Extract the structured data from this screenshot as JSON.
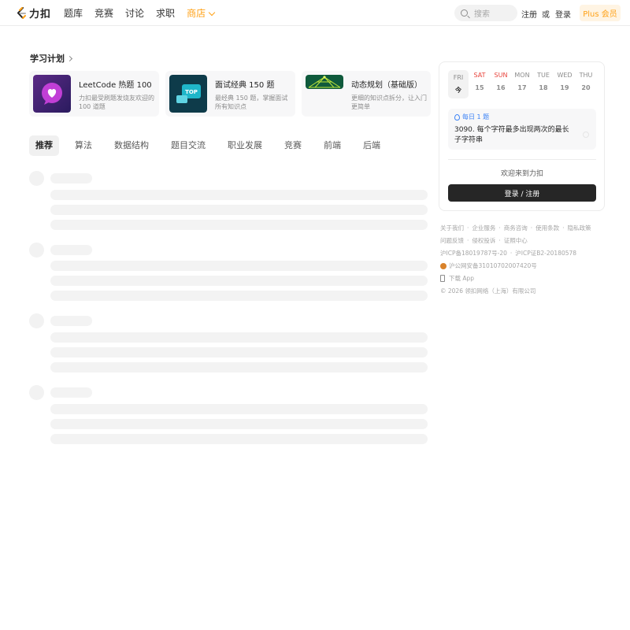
{
  "header": {
    "logo_text": "力扣",
    "nav": [
      "题库",
      "竞赛",
      "讨论",
      "求职"
    ],
    "shop_label": "商店",
    "search_placeholder": "搜索",
    "register": "注册",
    "or": "或",
    "login": "登录",
    "plus": "Plus 会员",
    "accent_color": "#ffa116"
  },
  "study_plan": {
    "title": "学习计划",
    "cards": [
      {
        "title": "LeetCode 热题 100",
        "desc": "力扣最受刷题发烧友欢迎的 100 道题",
        "icon": "chat-heart-icon"
      },
      {
        "title": "面试经典 150 题",
        "desc": "最经典 150 题，掌握面试所有知识点",
        "icon": "top-chat-icon"
      },
      {
        "title": "动态规划（基础版）",
        "desc": "更细的知识点拆分，让入门更简单",
        "icon": "network-graph-icon"
      }
    ]
  },
  "tabs": [
    "推荐",
    "算法",
    "数据结构",
    "题目交流",
    "职业发展",
    "竞赛",
    "前端",
    "后端"
  ],
  "calendar": {
    "days": [
      {
        "name": "FRI",
        "date": "今",
        "today": true
      },
      {
        "name": "SAT",
        "date": "15",
        "weekend": true
      },
      {
        "name": "SUN",
        "date": "16",
        "weekend": true
      },
      {
        "name": "MON",
        "date": "17"
      },
      {
        "name": "TUE",
        "date": "18"
      },
      {
        "name": "WED",
        "date": "19"
      },
      {
        "name": "THU",
        "date": "20"
      }
    ]
  },
  "daily": {
    "label": "每日 1 题",
    "question": "3090. 每个字符最多出现两次的最长子字符串"
  },
  "welcome": "欢迎来到力扣",
  "login_button": "登录 / 注册",
  "footer": {
    "links1": [
      "关于我们",
      "企业服务",
      "商务咨询",
      "使用条款",
      "隐私政策"
    ],
    "links2": [
      "问题反馈",
      "侵权投诉",
      "证照中心"
    ],
    "icp": "沪ICP备18019787号-20",
    "icp2": "沪ICP证B2-20180578",
    "police": "沪公网安备31010702007420号",
    "download": "下载 App",
    "copyright": "© 2026 领扣网络（上海）有限公司"
  }
}
